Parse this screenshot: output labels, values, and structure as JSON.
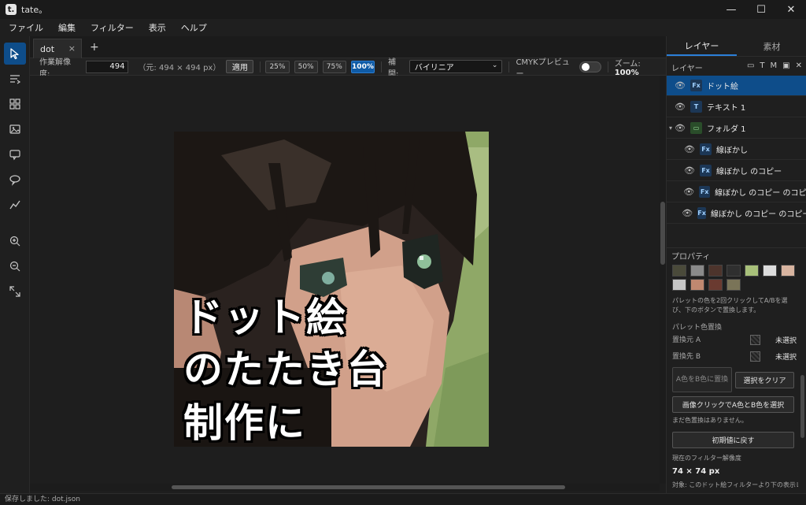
{
  "app": {
    "title": "tate。",
    "logo_letter": "t."
  },
  "window_controls": {
    "minimize": "—",
    "maximize": "☐",
    "close": "✕"
  },
  "menu": [
    "ファイル",
    "編集",
    "フィルター",
    "表示",
    "ヘルプ"
  ],
  "tools": [
    {
      "name": "select-tool",
      "icon": "cursor-icon",
      "active": true
    },
    {
      "name": "text-tool",
      "icon": "text-lines-icon",
      "active": false
    },
    {
      "name": "grid-tool",
      "icon": "grid-icon",
      "active": false
    },
    {
      "name": "image-tool",
      "icon": "image-icon",
      "active": false
    },
    {
      "name": "speech-bubble-tool",
      "icon": "speech-bubble-icon",
      "active": false
    },
    {
      "name": "balloon-tool",
      "icon": "balloon-icon",
      "active": false
    },
    {
      "name": "curve-tool",
      "icon": "curve-icon",
      "active": false
    },
    {
      "name": "zoom-in-tool",
      "icon": "zoom-in-icon",
      "active": false
    },
    {
      "name": "zoom-out-tool",
      "icon": "zoom-out-icon",
      "active": false
    },
    {
      "name": "fit-tool",
      "icon": "fit-screen-icon",
      "active": false
    }
  ],
  "tabs": {
    "doc_label": "dot",
    "close": "×",
    "add": "+"
  },
  "options": {
    "res_label": "作業解像度:",
    "res_value": "494",
    "original": "（元: 494 × 494 px）",
    "apply": "適用",
    "zoom_presets": [
      {
        "label": "25%",
        "active": false
      },
      {
        "label": "50%",
        "active": false
      },
      {
        "label": "75%",
        "active": false
      },
      {
        "label": "100%",
        "active": true
      }
    ],
    "interp_label": "補間:",
    "interp_value": "バイリニア",
    "cmyk_label": "CMYKプレビュー",
    "cmyk_on": false,
    "zoom_label": "ズーム:",
    "zoom_value": "100%"
  },
  "artwork": {
    "lines": [
      "ドット絵",
      "のたたき台",
      "制作に"
    ]
  },
  "right_panel": {
    "tabs": [
      {
        "label": "レイヤー",
        "active": true
      },
      {
        "label": "素材",
        "active": false
      }
    ],
    "layers_title": "レイヤー",
    "layer_actions": [
      "folder-icon",
      "T",
      "M",
      "image-icon",
      "✕"
    ],
    "layers": [
      {
        "name": "ドット絵",
        "type": "Fx",
        "indent": 0,
        "selected": true
      },
      {
        "name": "テキスト 1",
        "type": "T",
        "indent": 0,
        "selected": false
      },
      {
        "name": "フォルダ 1",
        "type": "folder",
        "indent": 0,
        "selected": false,
        "expanded": true
      },
      {
        "name": "線ぼかし",
        "type": "Fx",
        "indent": 1,
        "selected": false
      },
      {
        "name": "線ぼかし のコピー",
        "type": "Fx",
        "indent": 1,
        "selected": false
      },
      {
        "name": "線ぼかし のコピー のコピー",
        "type": "Fx",
        "indent": 1,
        "selected": false
      },
      {
        "name": "線ぼかし のコピー のコピー のコピー",
        "type": "Fx",
        "indent": 1,
        "selected": false
      }
    ],
    "props_title": "プロパティ",
    "palette": [
      "#4a4a3a",
      "#8a8a8a",
      "#4d342c",
      "#2f2f2f",
      "#a8c07a",
      "#dcdcdc",
      "#d8b4a0",
      "#c6c6c6",
      "#c08870",
      "#6a3a30",
      "#7a7458"
    ],
    "palette_note": "パレットの色を2回クリックしてA/Bを選び、下のボタンで置換します。",
    "replace_title": "パレット色置換",
    "source_label": "置換元 A",
    "source_value": "未選択",
    "target_label": "置換先 B",
    "target_value": "未選択",
    "btn_replace": "A色をB色に置換",
    "btn_clear": "選択をクリア",
    "btn_image_click": "画像クリックでA色とB色を選択",
    "no_replace": "まだ色置換はありません。",
    "btn_reset": "初期値に戻す",
    "filter_res_label": "現在のフィルター解像度",
    "filter_res_value": "74 × 74 px",
    "target_note": "対象: このドット絵フィルターより下の表示レイヤー"
  },
  "status": {
    "message": "保存しました: dot.json"
  }
}
